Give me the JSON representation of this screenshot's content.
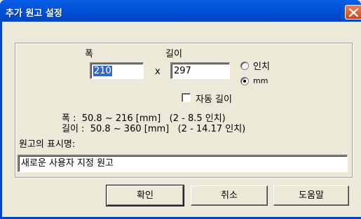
{
  "window": {
    "title": "추가 원고 설정"
  },
  "size": {
    "width_label": "폭",
    "length_label": "길이",
    "width_value": "210",
    "times": "x",
    "length_value": "297",
    "unit_inch": "인치",
    "unit_mm": "mm",
    "selected_unit": "mm",
    "auto_length_label": "자동 길이",
    "auto_length_checked": false
  },
  "ranges": {
    "width": "폭 :  50.8 ~ 216 [mm]   (2 - 8.5 인치)",
    "length": "길이 :  50.8 ~ 360 [mm]   (2 - 14.17 인치)"
  },
  "display_name": {
    "label": "원고의 표시명:",
    "value": "새로운 사용자 지정 원고"
  },
  "buttons": {
    "ok": "확인",
    "cancel": "취소",
    "help": "도움말"
  }
}
